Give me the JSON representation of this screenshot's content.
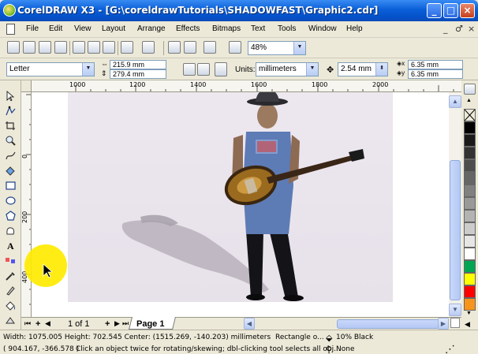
{
  "window": {
    "title": "CorelDRAW X3 - [G:\\coreldrawTutorials\\SHADOWFAST\\Graphic2.cdr]",
    "controls": {
      "minimize": "_",
      "maximize": "□",
      "close": "×"
    },
    "mdi_controls": [
      "_",
      "♂",
      "×"
    ]
  },
  "menu": {
    "items": [
      {
        "label": "File"
      },
      {
        "label": "Edit"
      },
      {
        "label": "View"
      },
      {
        "label": "Layout"
      },
      {
        "label": "Arrange"
      },
      {
        "label": "Effects"
      },
      {
        "label": "Bitmaps"
      },
      {
        "label": "Text"
      },
      {
        "label": "Tools"
      },
      {
        "label": "Window"
      },
      {
        "label": "Help"
      }
    ]
  },
  "toolbar": {
    "zoom_value": "48%"
  },
  "property_bar": {
    "page_size": "Letter",
    "page_width": "215.9 mm",
    "page_height": "279.4 mm",
    "units_label": "Units:",
    "units_value": "millimeters",
    "nudge_value": "2.54 mm",
    "dup_x": "6.35 mm",
    "dup_y": "6.35 mm"
  },
  "rulers": {
    "h_ticks": [
      "1000",
      "1200",
      "1400",
      "1600",
      "1800",
      "2000"
    ],
    "v_ticks": [
      "0",
      "200",
      "400"
    ],
    "v_unit": "millimeters"
  },
  "page_nav": {
    "counter": "1 of 1",
    "tab_label": "Page 1"
  },
  "status": {
    "dimensions": "Width: 1075.005  Height: 702.545  Center: (1515.269, -140.203)  millimeters",
    "object_type": "Rectangle o...",
    "fill_info": "10% Black",
    "cursor_pos": "( 904.167, -366.578 )",
    "hint": "Click an object twice for rotating/skewing; dbl-clicking tool selects all obj...",
    "outline_info": "None"
  },
  "palette": {
    "colors": [
      "#ffffff",
      "#000000",
      "#1a1a1a",
      "#333333",
      "#4d4d4d",
      "#666666",
      "#808080",
      "#999999",
      "#b3b3b3",
      "#cccccc",
      "#e6e6e6",
      "#ffffff",
      "#00a651",
      "#ffff00",
      "#ff0000",
      "#f7941d"
    ]
  }
}
